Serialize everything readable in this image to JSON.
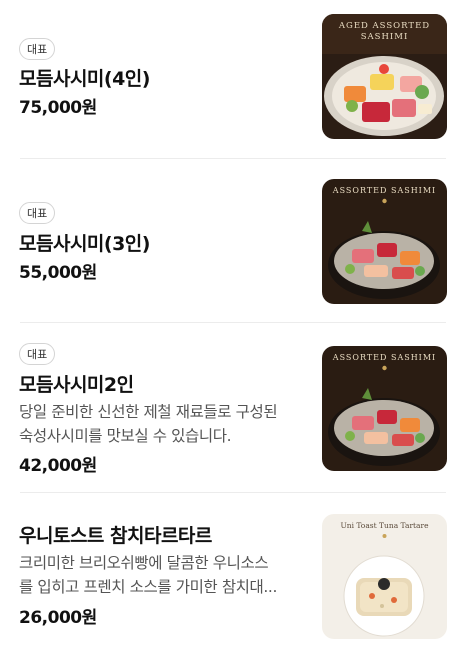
{
  "menu": {
    "items": [
      {
        "badge": "대표",
        "name": "모듬사시미(4인)",
        "price": "75,000원",
        "image_title_line1": "AGED ASSORTED",
        "image_title_line2": "SASHIMI"
      },
      {
        "badge": "대표",
        "name": "모듬사시미(3인)",
        "price": "55,000원",
        "image_title": "ASSORTED SASHIMI"
      },
      {
        "badge": "대표",
        "name": "모듬사시미2인",
        "description_line1": "당일 준비한 신선한 제철 재료들로 구성된",
        "description_line2": "숙성사시미를 맛보실 수 있습니다.",
        "price": "42,000원",
        "image_title": "ASSORTED SASHIMI"
      },
      {
        "name": "우니토스트 참치타르타르",
        "description_line1": "크리미한 브리오쉬빵에 달콤한 우니소스",
        "description_line2": "를 입히고 프렌치 소스를 가미한 참치대...",
        "price": "26,000원",
        "image_title": "Uni Toast Tuna Tartare"
      }
    ]
  },
  "colors": {
    "badge_border": "#d4d4d4",
    "divider": "#ececec",
    "text_primary": "#111111",
    "text_secondary": "#555555",
    "dark_photo_bg": "#2b1d14",
    "light_photo_bg": "#f3efe8"
  }
}
